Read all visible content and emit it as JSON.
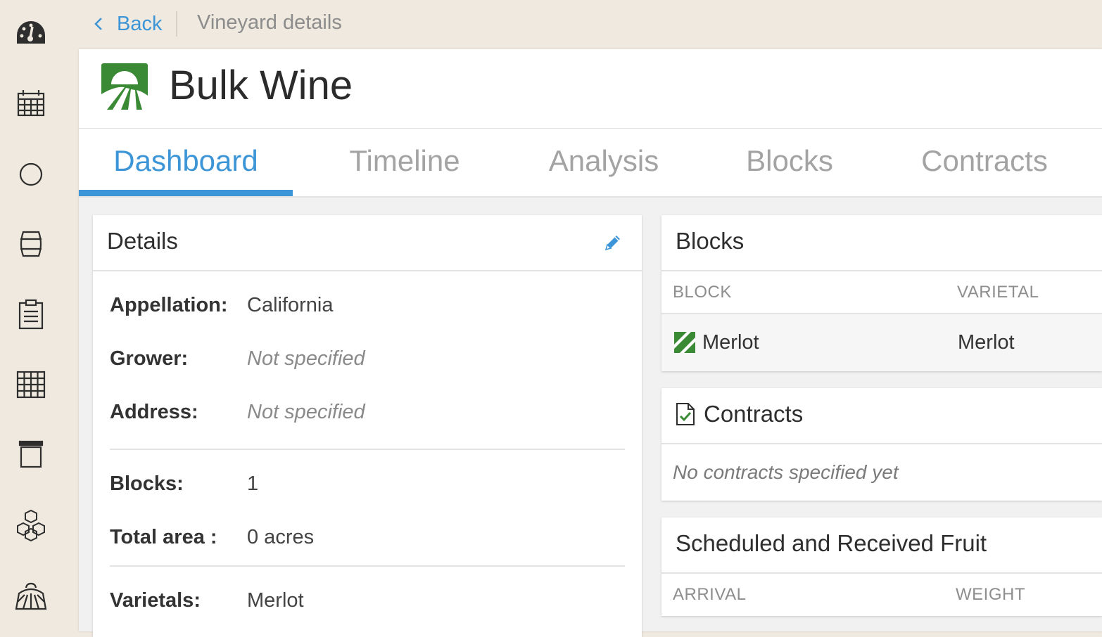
{
  "breadcrumb": {
    "back_label": "Back",
    "title": "Vineyard details"
  },
  "sidebar": {
    "items": [
      {
        "icon": "dashboard-gauge-icon"
      },
      {
        "icon": "calendar-icon"
      },
      {
        "icon": "circle-icon"
      },
      {
        "icon": "barrel-icon"
      },
      {
        "icon": "clipboard-icon"
      },
      {
        "icon": "grid-icon"
      },
      {
        "icon": "bin-icon"
      },
      {
        "icon": "boxes-icon"
      },
      {
        "icon": "vineyard-icon"
      }
    ]
  },
  "header": {
    "title": "Bulk Wine",
    "logo_color": "#3a8a35"
  },
  "tabs": [
    "Dashboard",
    "Timeline",
    "Analysis",
    "Blocks",
    "Contracts"
  ],
  "active_tab": "Dashboard",
  "colors": {
    "accent": "#3b95d6",
    "background": "#efe9df",
    "green": "#3a8a35"
  },
  "details": {
    "title": "Details",
    "rows": [
      {
        "label": "Appellation:",
        "value": "California"
      },
      {
        "label": "Grower:",
        "value": "Not specified"
      },
      {
        "label": "Address:",
        "value": "Not specified"
      },
      {
        "label": "Blocks:",
        "value": "1"
      },
      {
        "label": "Total area :",
        "value": "0 acres"
      },
      {
        "label": "Varietals:",
        "value": "Merlot"
      }
    ]
  },
  "blocks": {
    "title": "Blocks",
    "columns": [
      "BLOCK",
      "VARIETAL"
    ],
    "rows": [
      {
        "block": "Merlot",
        "varietal": "Merlot"
      }
    ]
  },
  "contracts": {
    "title": "Contracts",
    "empty_text": "No contracts specified yet"
  },
  "fruit": {
    "title": "Scheduled and Received Fruit",
    "columns": [
      "ARRIVAL",
      "WEIGHT"
    ]
  }
}
